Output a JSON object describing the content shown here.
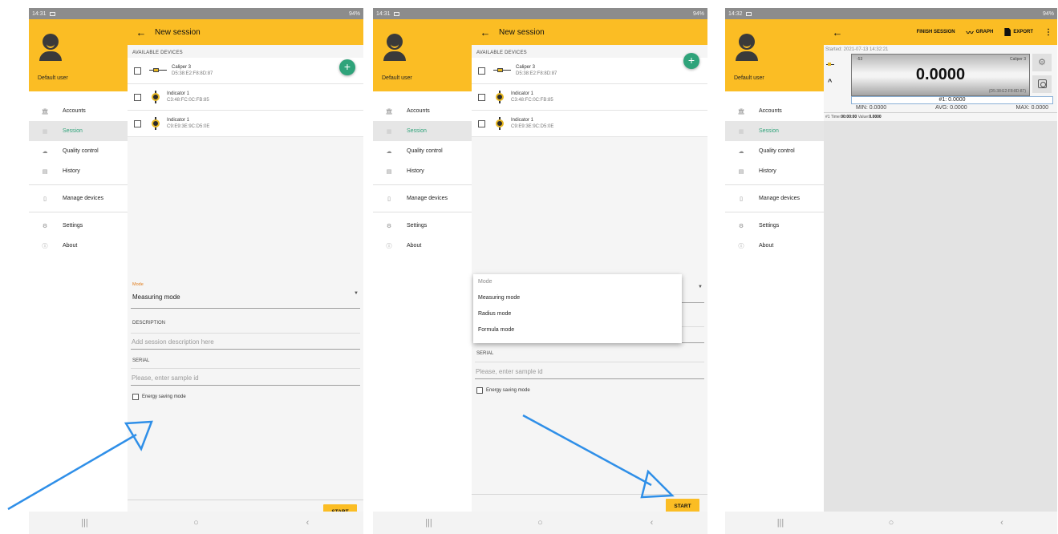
{
  "screens": [
    {
      "status": {
        "time": "14:31",
        "battery": "94%"
      },
      "user_name": "Default user",
      "menu": [
        "Accounts",
        "Session",
        "Quality control",
        "History",
        "Manage devices",
        "Settings",
        "About"
      ],
      "title": "New session",
      "section": "AVAILABLE DEVICES",
      "devices": [
        {
          "name": "Caliper 3",
          "mac": "D5:38:E2:F8:8D:87"
        },
        {
          "name": "Indicator 1",
          "mac": "C3:48:FC:0C:FB:85"
        },
        {
          "name": "Indicator 1",
          "mac": "C9:E9:3E:9C:D5:0E"
        }
      ],
      "mode_label": "Mode",
      "mode_value": "Measuring mode",
      "description_label": "DESCRIPTION",
      "description_placeholder": "Add session description here",
      "serial_label": "SERIAL",
      "serial_placeholder": "Please, enter sample id",
      "energy_saving": "Energy saving mode",
      "start": "START"
    },
    {
      "status": {
        "time": "14:31",
        "battery": "94%"
      },
      "user_name": "Default user",
      "menu": [
        "Accounts",
        "Session",
        "Quality control",
        "History",
        "Manage devices",
        "Settings",
        "About"
      ],
      "title": "New session",
      "section": "AVAILABLE DEVICES",
      "devices": [
        {
          "name": "Caliper 3",
          "mac": "D5:38:E2:F8:8D:87"
        },
        {
          "name": "Indicator 1",
          "mac": "C3:48:FC:0C:FB:85"
        },
        {
          "name": "Indicator 1",
          "mac": "C9:E9:3E:9C:D5:0E"
        }
      ],
      "dropdown": {
        "header": "Mode",
        "options": [
          "Measuring mode",
          "Radius mode",
          "Formula mode"
        ]
      },
      "serial_label": "SERIAL",
      "serial_placeholder": "Please, enter sample id",
      "energy_saving": "Energy saving mode",
      "start": "START"
    },
    {
      "status": {
        "time": "14:32",
        "battery": "94%"
      },
      "user_name": "Default user",
      "menu": [
        "Accounts",
        "Session",
        "Quality control",
        "History",
        "Manage devices",
        "Settings",
        "About"
      ],
      "actions": {
        "finish": "FINISH SESSION",
        "graph": "GRAPH",
        "export": "EXPORT"
      },
      "started": "Started: 2021-07-13 14:32:21",
      "display": {
        "battery": "-53",
        "name": "Caliper 3",
        "value": "0.0000",
        "mac": "(D5:38:E2:F8:8D:87)"
      },
      "first": "#1: 0.0000",
      "stats": {
        "min": "MIN: 0.0000",
        "avg": "AVG: 0.0000",
        "max": "MAX: 0.0000"
      },
      "log": {
        "prefix": "#1 Time:",
        "time": "00:00:00",
        "value_label": "Value:",
        "value": "0.0000"
      }
    }
  ],
  "colors": {
    "accent": "#fbbd24",
    "active": "#2fa37a",
    "arrow": "#2f8fe8"
  }
}
